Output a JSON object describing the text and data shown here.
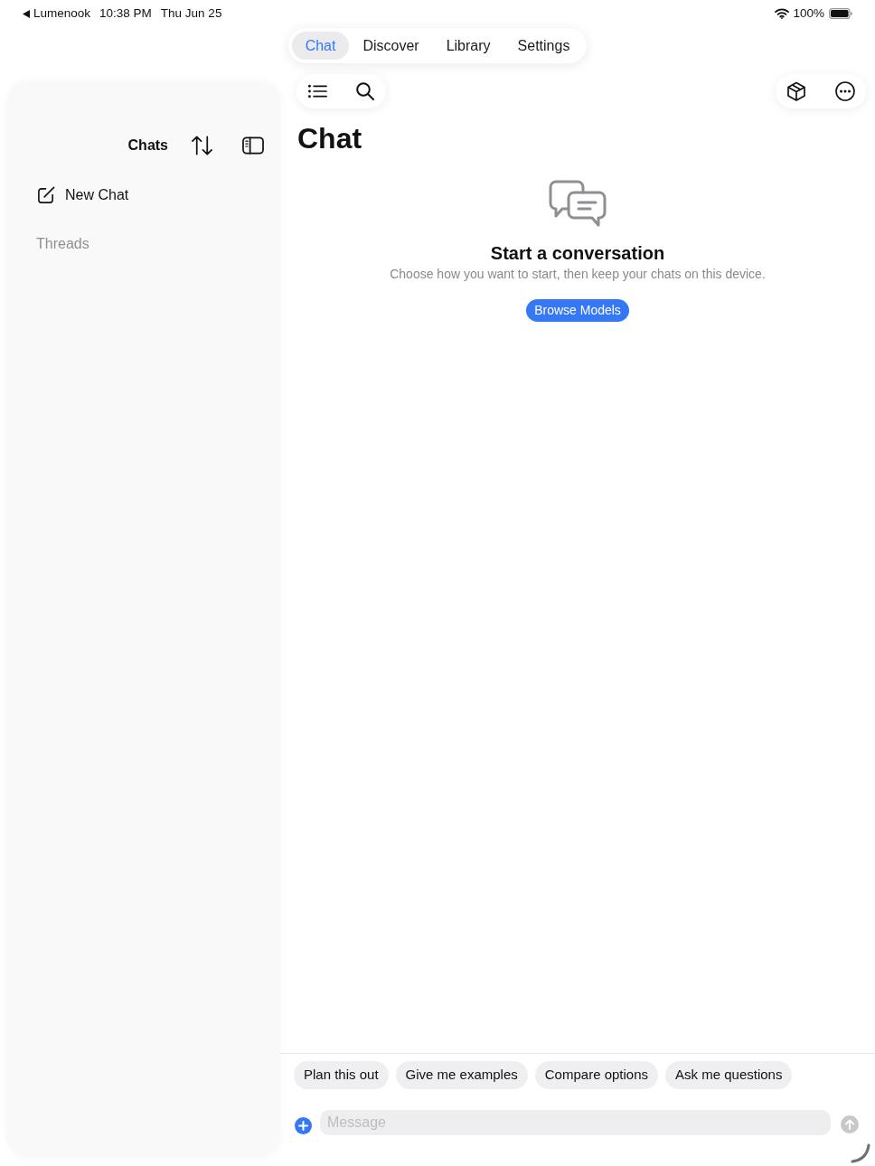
{
  "status_bar": {
    "back_app": "Lumenook",
    "time": "10:38 PM",
    "date": "Thu Jun 25",
    "battery": "100%"
  },
  "tabs": [
    {
      "label": "Chat",
      "selected": true
    },
    {
      "label": "Discover",
      "selected": false
    },
    {
      "label": "Library",
      "selected": false
    },
    {
      "label": "Settings",
      "selected": false
    }
  ],
  "sidebar": {
    "title": "Chats",
    "new_chat": "New Chat",
    "section": "Threads"
  },
  "main": {
    "title": "Chat",
    "empty_state": {
      "title": "Start a conversation",
      "subtitle": "Choose how you want to start, then keep your chats on this device.",
      "button": "Browse Models"
    }
  },
  "suggestions": [
    "Plan this out",
    "Give me examples",
    "Compare options",
    "Ask me questions"
  ],
  "composer": {
    "placeholder": "Message"
  }
}
